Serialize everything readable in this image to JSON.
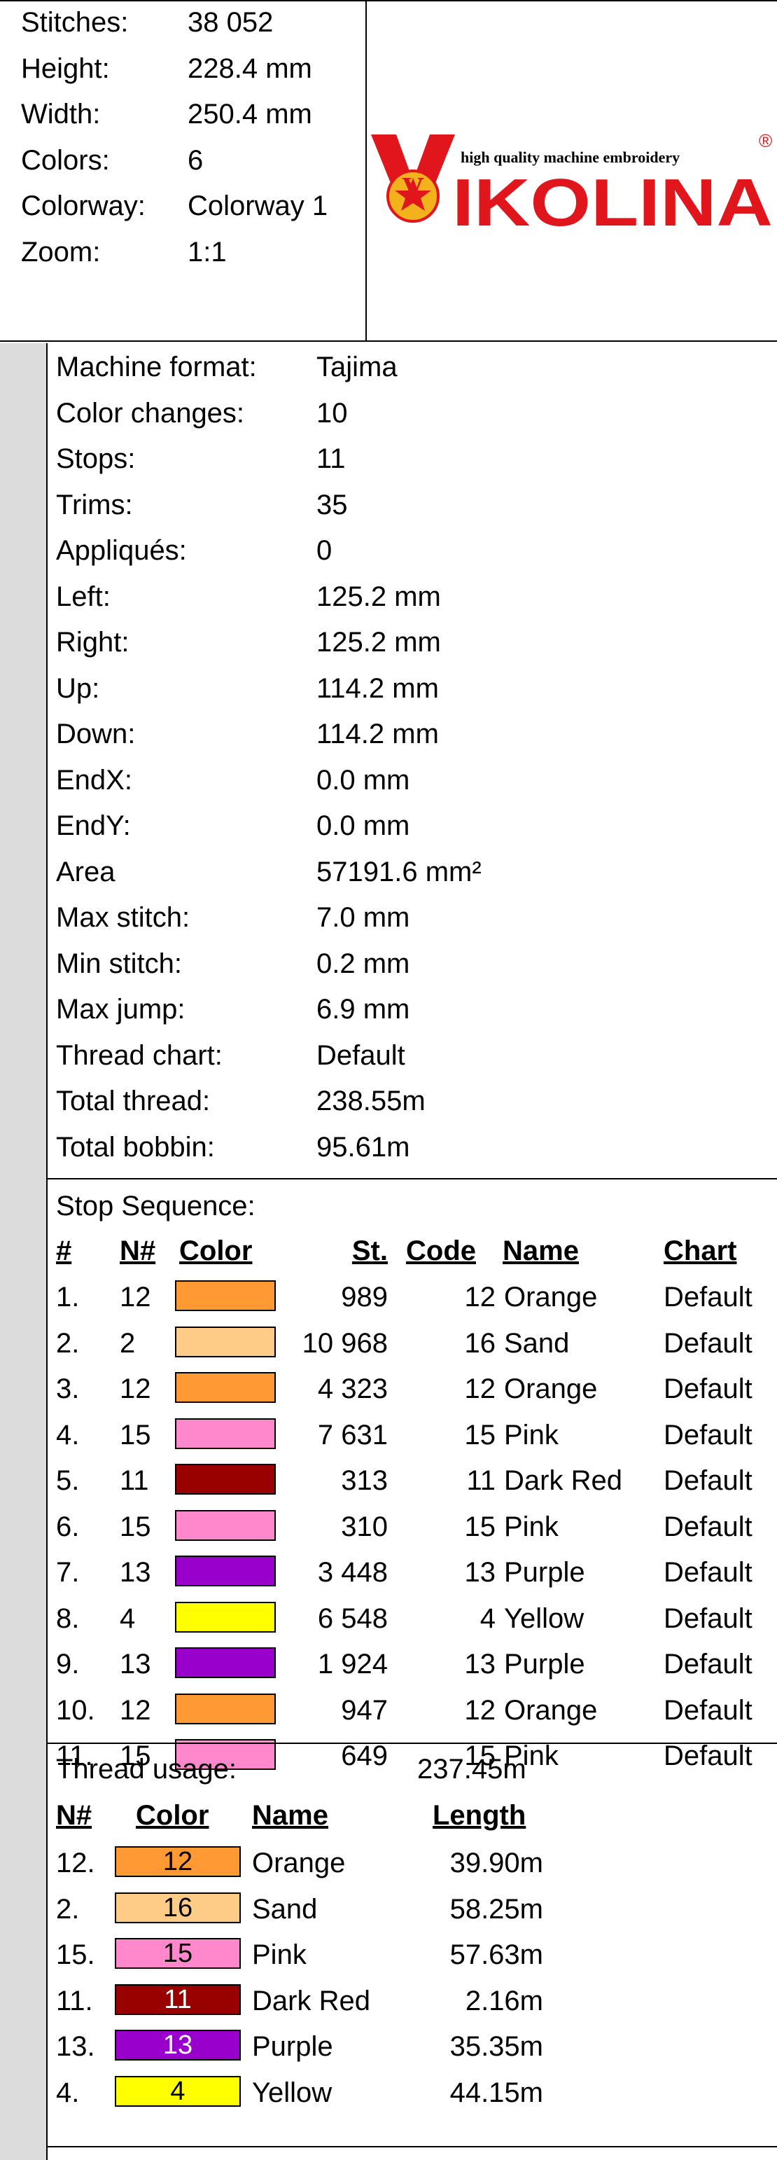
{
  "summary": {
    "rows": [
      {
        "label": "Stitches:",
        "value": "38 052"
      },
      {
        "label": "Height:",
        "value": "228.4 mm"
      },
      {
        "label": "Width:",
        "value": "250.4 mm"
      },
      {
        "label": "Colors:",
        "value": "6"
      },
      {
        "label": "Colorway:",
        "value": "Colorway 1"
      },
      {
        "label": "Zoom:",
        "value": "1:1"
      }
    ]
  },
  "logo": {
    "tagline": "high quality machine embroidery",
    "brand": "IKOLINA",
    "initial": "V",
    "registered": "®",
    "brand_color": "#e0161c",
    "medal_color": "#f2b21c"
  },
  "details": {
    "rows": [
      {
        "label": "Machine format:",
        "value": "Tajima"
      },
      {
        "label": "Color changes:",
        "value": "10"
      },
      {
        "label": "Stops:",
        "value": "11"
      },
      {
        "label": "Trims:",
        "value": "35"
      },
      {
        "label": "Appliqués:",
        "value": "0"
      },
      {
        "label": "Left:",
        "value": "125.2 mm"
      },
      {
        "label": "Right:",
        "value": "125.2 mm"
      },
      {
        "label": "Up:",
        "value": "114.2 mm"
      },
      {
        "label": "Down:",
        "value": "114.2 mm"
      },
      {
        "label": "EndX:",
        "value": "0.0 mm"
      },
      {
        "label": "EndY:",
        "value": "0.0 mm"
      },
      {
        "label": "Area",
        "value": "57191.6 mm²"
      },
      {
        "label": "Max stitch:",
        "value": "7.0 mm"
      },
      {
        "label": "Min stitch:",
        "value": "0.2 mm"
      },
      {
        "label": "Max jump:",
        "value": "6.9 mm"
      },
      {
        "label": "Thread chart:",
        "value": "Default"
      },
      {
        "label": "Total thread:",
        "value": "238.55m"
      },
      {
        "label": "Total bobbin:",
        "value": "95.61m"
      }
    ]
  },
  "stop_sequence": {
    "title": "Stop Sequence:",
    "headers": {
      "idx": "#",
      "n": "N#",
      "color": "Color",
      "st": "St.",
      "code": "Code",
      "name": "Name",
      "chart": "Chart"
    },
    "rows": [
      {
        "idx": "1.",
        "n": "12",
        "color": "#ff9933",
        "st": "989",
        "code": "12",
        "name": "Orange",
        "chart": "Default"
      },
      {
        "idx": "2.",
        "n": "2",
        "color": "#ffcc88",
        "st": "10 968",
        "code": "16",
        "name": "Sand",
        "chart": "Default"
      },
      {
        "idx": "3.",
        "n": "12",
        "color": "#ff9933",
        "st": "4 323",
        "code": "12",
        "name": "Orange",
        "chart": "Default"
      },
      {
        "idx": "4.",
        "n": "15",
        "color": "#ff88cc",
        "st": "7 631",
        "code": "15",
        "name": "Pink",
        "chart": "Default"
      },
      {
        "idx": "5.",
        "n": "11",
        "color": "#990000",
        "st": "313",
        "code": "11",
        "name": "Dark Red",
        "chart": "Default"
      },
      {
        "idx": "6.",
        "n": "15",
        "color": "#ff88cc",
        "st": "310",
        "code": "15",
        "name": "Pink",
        "chart": "Default"
      },
      {
        "idx": "7.",
        "n": "13",
        "color": "#9900cc",
        "st": "3 448",
        "code": "13",
        "name": "Purple",
        "chart": "Default"
      },
      {
        "idx": "8.",
        "n": "4",
        "color": "#ffff00",
        "st": "6 548",
        "code": "4",
        "name": "Yellow",
        "chart": "Default"
      },
      {
        "idx": "9.",
        "n": "13",
        "color": "#9900cc",
        "st": "1 924",
        "code": "13",
        "name": "Purple",
        "chart": "Default"
      },
      {
        "idx": "10.",
        "n": "12",
        "color": "#ff9933",
        "st": "947",
        "code": "12",
        "name": "Orange",
        "chart": "Default"
      },
      {
        "idx": "11.",
        "n": "15",
        "color": "#ff88cc",
        "st": "649",
        "code": "15",
        "name": "Pink",
        "chart": "Default"
      }
    ]
  },
  "thread_usage": {
    "title": "Thread usage:",
    "total": "237.45m",
    "headers": {
      "n": "N#",
      "color": "Color",
      "name": "Name",
      "length": "Length"
    },
    "rows": [
      {
        "n": "12.",
        "color": "#ff9933",
        "code": "12",
        "text_color": "#000000",
        "name": "Orange",
        "length": "39.90m"
      },
      {
        "n": "2.",
        "color": "#ffcc88",
        "code": "16",
        "text_color": "#000000",
        "name": "Sand",
        "length": "58.25m"
      },
      {
        "n": "15.",
        "color": "#ff88cc",
        "code": "15",
        "text_color": "#000000",
        "name": "Pink",
        "length": "57.63m"
      },
      {
        "n": "11.",
        "color": "#990000",
        "code": "11",
        "text_color": "#ffffff",
        "name": "Dark Red",
        "length": "2.16m"
      },
      {
        "n": "13.",
        "color": "#9900cc",
        "code": "13",
        "text_color": "#ffffff",
        "name": "Purple",
        "length": "35.35m"
      },
      {
        "n": "4.",
        "color": "#ffff00",
        "code": "4",
        "text_color": "#000000",
        "name": "Yellow",
        "length": "44.15m"
      }
    ]
  }
}
